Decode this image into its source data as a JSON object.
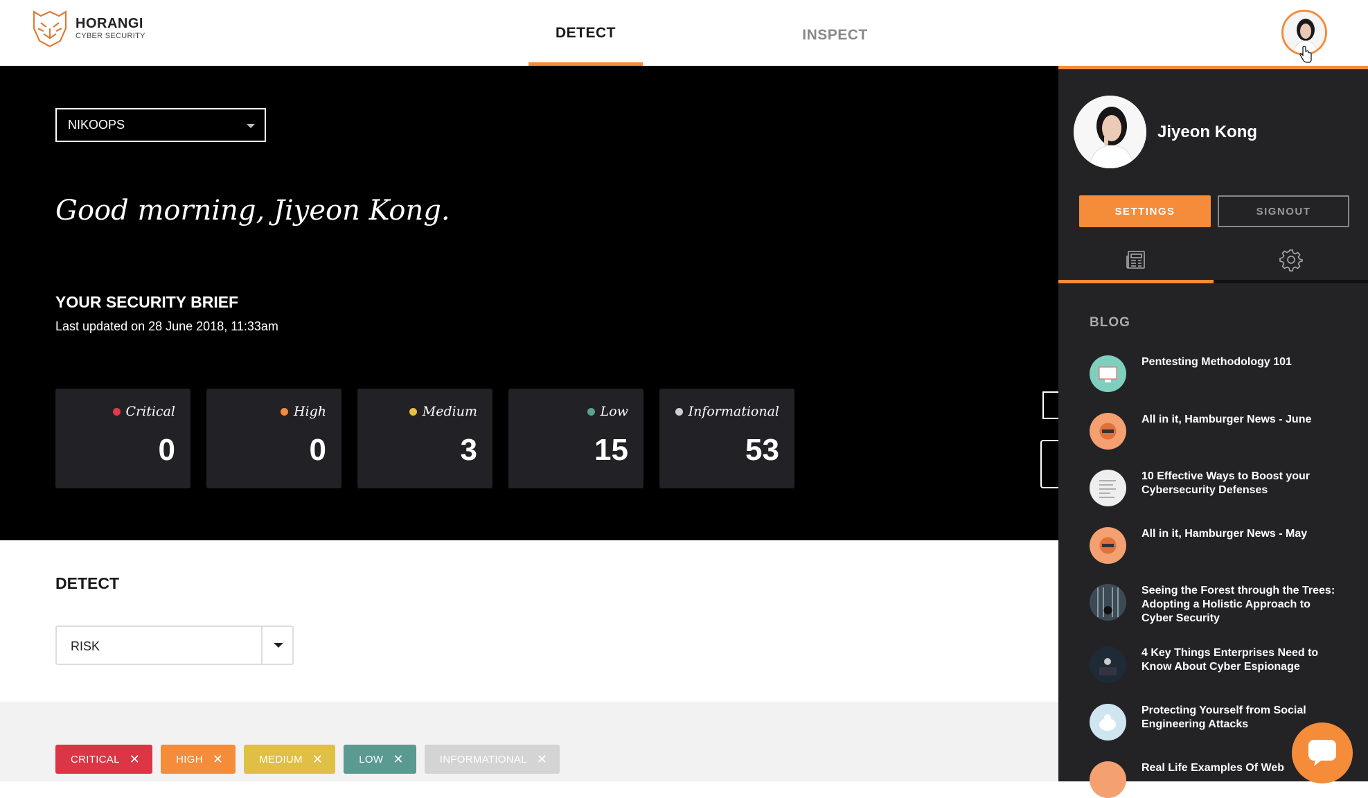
{
  "header": {
    "logo_name": "HORANGI",
    "logo_sub": "CYBER SECURITY",
    "tabs": [
      {
        "label": "DETECT",
        "active": true
      },
      {
        "label": "INSPECT",
        "active": false
      }
    ]
  },
  "hero": {
    "org_selected": "NIKOOPS",
    "greeting": "Good morning, Jiyeon Kong.",
    "brief_title": "YOUR SECURITY BRIEF",
    "brief_updated": "Last updated on 28 June 2018, 11:33am",
    "cards": [
      {
        "label": "Critical",
        "value": "0",
        "color": "#e03a4b"
      },
      {
        "label": "High",
        "value": "0",
        "color": "#f48c3a"
      },
      {
        "label": "Medium",
        "value": "3",
        "color": "#e6c245"
      },
      {
        "label": "Low",
        "value": "15",
        "color": "#5aa093"
      },
      {
        "label": "Informational",
        "value": "53",
        "color": "#d0d0d0"
      }
    ]
  },
  "detect": {
    "title": "DETECT",
    "sort_selected": "RISK",
    "chips": [
      {
        "label": "CRITICAL",
        "color": "#dc3545"
      },
      {
        "label": "HIGH",
        "color": "#f48c3a"
      },
      {
        "label": "MEDIUM",
        "color": "#e0bf45"
      },
      {
        "label": "LOW",
        "color": "#5a9a90"
      },
      {
        "label": "INFORMATIONAL",
        "color": "#d4d4d4"
      }
    ]
  },
  "panel": {
    "user_name": "Jiyeon Kong",
    "settings_label": "SETTINGS",
    "signout_label": "SIGNOUT",
    "tabs": [
      {
        "icon": "newspaper-icon",
        "active": true
      },
      {
        "icon": "gear-icon",
        "active": false
      }
    ],
    "blog_heading": "BLOG",
    "blog_items": [
      {
        "title": "Pentesting Methodology 101",
        "thumb": "#7fcfbf"
      },
      {
        "title": "All in it, Hamburger News - June",
        "thumb": "#f4a070"
      },
      {
        "title": "10 Effective Ways to Boost your Cybersecurity Defenses",
        "thumb": "#eeeeee"
      },
      {
        "title": "All in it, Hamburger News - May",
        "thumb": "#f4a070"
      },
      {
        "title": "Seeing the Forest through the Trees:  Adopting a Holistic Approach to Cyber Security",
        "thumb": "#3c4a55"
      },
      {
        "title": "4 Key Things Enterprises Need to Know About Cyber Espionage",
        "thumb": "#1e2a35"
      },
      {
        "title": "Protecting Yourself from Social Engineering Attacks",
        "thumb": "#cfe6f0"
      },
      {
        "title": "Real Life Examples Of Web",
        "thumb": "#f4a070"
      }
    ]
  },
  "colors": {
    "accent": "#f48c3a",
    "panel_bg": "#232326",
    "card_bg": "#222226"
  }
}
